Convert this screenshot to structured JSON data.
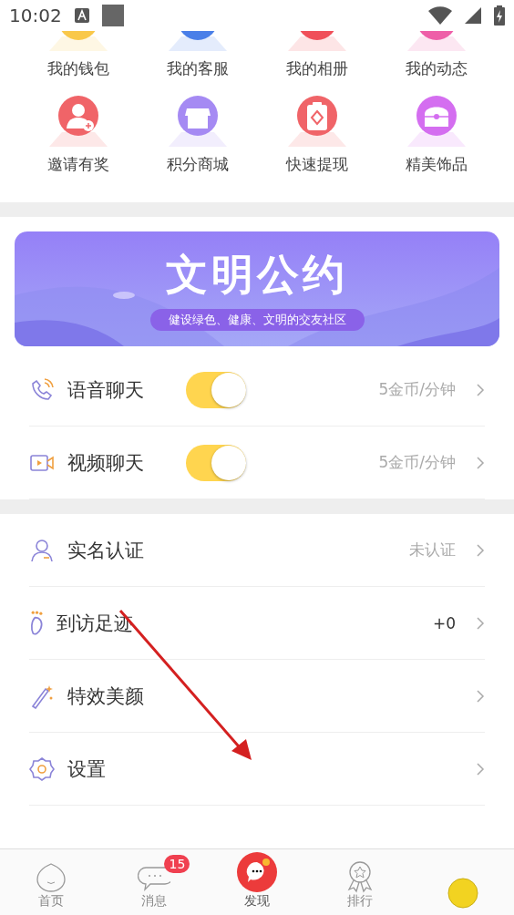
{
  "status_bar": {
    "time": "10:02"
  },
  "grid": [
    {
      "label": "我的钱包",
      "color": "#f9c84a",
      "cut": true
    },
    {
      "label": "我的客服",
      "color": "#4a7fe8",
      "cut": true
    },
    {
      "label": "我的相册",
      "color": "#f0505a",
      "cut": true
    },
    {
      "label": "我的动态",
      "color": "#ee5fa8",
      "cut": true
    },
    {
      "label": "邀请有奖",
      "color": "#f06468",
      "cut": false
    },
    {
      "label": "积分商城",
      "color": "#a58af3",
      "cut": false
    },
    {
      "label": "快速提现",
      "color": "#f06468",
      "cut": false
    },
    {
      "label": "精美饰品",
      "color": "#d46ef0",
      "cut": false
    }
  ],
  "banner": {
    "title": "文明公约",
    "subtitle": "健设绿色、健康、文明的交友社区"
  },
  "chat_settings": [
    {
      "kind": "phone",
      "label": "语音聊天",
      "on": true,
      "price": "5金币/分钟"
    },
    {
      "kind": "video",
      "label": "视频聊天",
      "on": true,
      "price": "5金币/分钟"
    }
  ],
  "menu": [
    {
      "kind": "person",
      "label": "实名认证",
      "value": "未认证"
    },
    {
      "kind": "foot",
      "label": "到访足迹",
      "value": "+0"
    },
    {
      "kind": "wand",
      "label": "特效美颜"
    },
    {
      "kind": "gear",
      "label": "设置"
    }
  ],
  "tab_bar": [
    {
      "kind": "home",
      "label": "首页",
      "selected": false
    },
    {
      "kind": "message",
      "label": "消息",
      "badge": "15",
      "selected": false
    },
    {
      "kind": "discover",
      "label": "发现",
      "selected": true
    },
    {
      "kind": "rank",
      "label": "排行",
      "selected": false
    },
    {
      "kind": "avatar",
      "selected": false
    }
  ]
}
